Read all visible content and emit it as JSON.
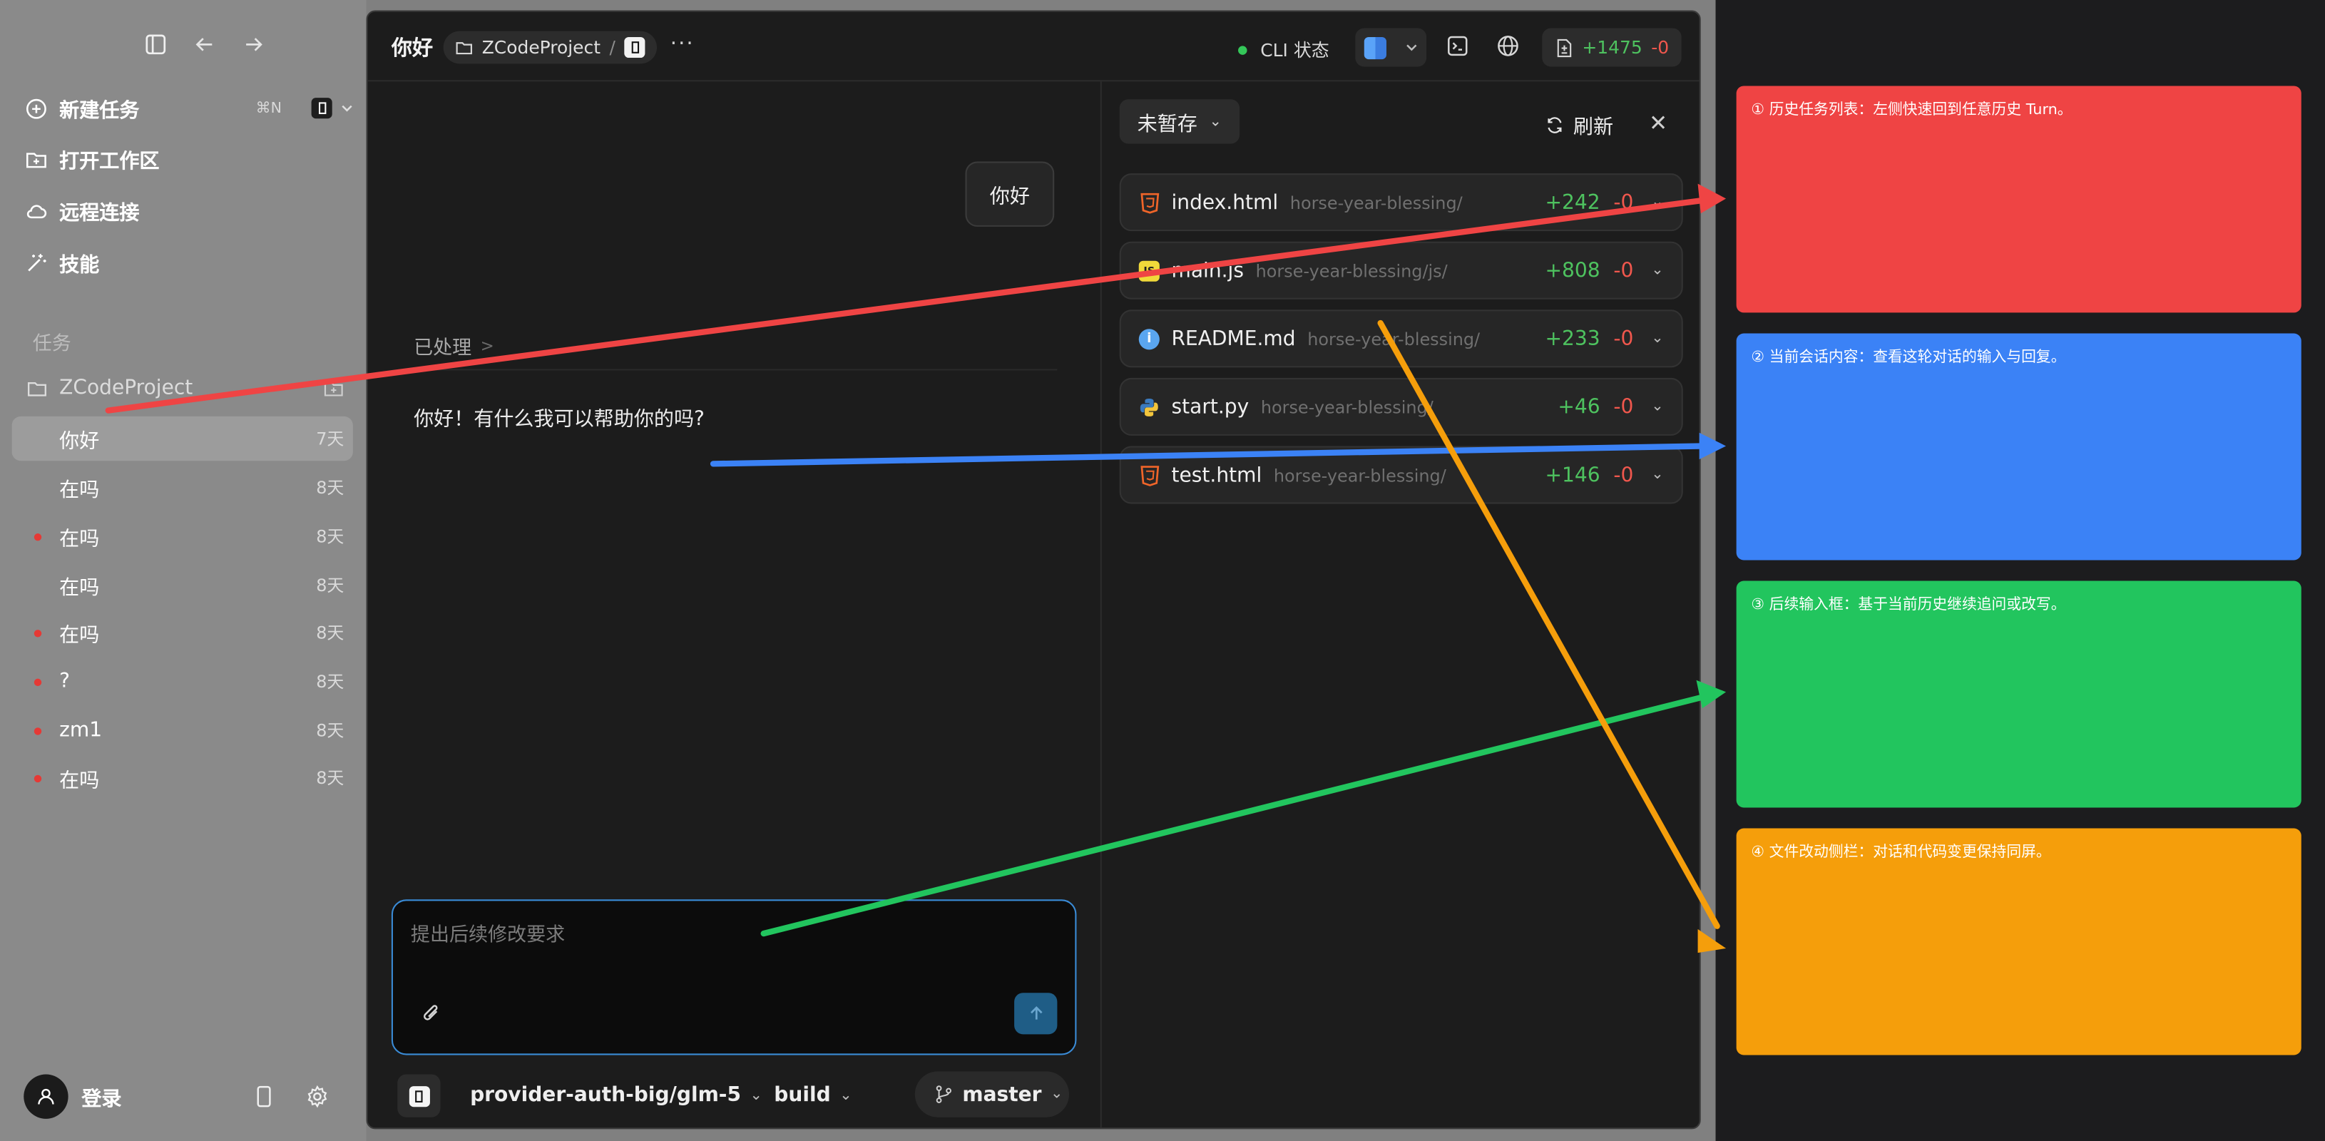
{
  "sidebar": {
    "actions": [
      {
        "label": "新建任务",
        "shortcut": "⌘N"
      },
      {
        "label": "打开工作区"
      },
      {
        "label": "远程连接"
      },
      {
        "label": "技能"
      }
    ],
    "section_title": "任务",
    "project": "ZCodeProject",
    "tasks": [
      {
        "label": "你好",
        "age": "7天",
        "active": true,
        "dot": false
      },
      {
        "label": "在吗",
        "age": "8天",
        "active": false,
        "dot": false
      },
      {
        "label": "在吗",
        "age": "8天",
        "active": false,
        "dot": true
      },
      {
        "label": "在吗",
        "age": "8天",
        "active": false,
        "dot": false
      },
      {
        "label": "在吗",
        "age": "8天",
        "active": false,
        "dot": true
      },
      {
        "label": "?",
        "age": "8天",
        "active": false,
        "dot": true
      },
      {
        "label": "zm1",
        "age": "8天",
        "active": false,
        "dot": true
      },
      {
        "label": "在吗",
        "age": "8天",
        "active": false,
        "dot": true
      }
    ],
    "login_label": "登录"
  },
  "topbar": {
    "title": "你好",
    "project": "ZCodeProject",
    "cli_label": "CLI 状态",
    "diff_plus": "+1475",
    "diff_minus": "-0"
  },
  "chat": {
    "user_message": "你好",
    "processed_label": "已处理",
    "reply": "你好！有什么我可以帮助你的吗?",
    "input_placeholder": "提出后续修改要求",
    "model": "provider-auth-big/glm-5",
    "mode": "build",
    "branch": "master"
  },
  "files_panel": {
    "stash_label": "未暂存",
    "refresh_label": "刷新",
    "files": [
      {
        "name": "index.html",
        "path": "horse-year-blessing/",
        "plus": "+242",
        "minus": "-0",
        "icon": "html-icon"
      },
      {
        "name": "main.js",
        "path": "horse-year-blessing/js/",
        "plus": "+808",
        "minus": "-0",
        "icon": "js-icon"
      },
      {
        "name": "README.md",
        "path": "horse-year-blessing/",
        "plus": "+233",
        "minus": "-0",
        "icon": "info-icon"
      },
      {
        "name": "start.py",
        "path": "horse-year-blessing/",
        "plus": "+46",
        "minus": "-0",
        "icon": "python-icon"
      },
      {
        "name": "test.html",
        "path": "horse-year-blessing/",
        "plus": "+146",
        "minus": "-0",
        "icon": "html-icon"
      }
    ]
  },
  "annotations": [
    {
      "text": "① 历史任务列表：左侧快速回到任意历史 Turn。",
      "color": "#ef4444"
    },
    {
      "text": "② 当前会话内容：查看这轮对话的输入与回复。",
      "color": "#3b82f6"
    },
    {
      "text": "③ 后续输入框：基于当前历史继续追问或改写。",
      "color": "#22c55e"
    },
    {
      "text": "④ 文件改动侧栏：对话和代码变更保持同屏。",
      "color": "#f59e0b"
    }
  ],
  "colors": {
    "plus": "#4ec25f",
    "minus": "#f0574d",
    "focus": "#3a8bd6"
  }
}
